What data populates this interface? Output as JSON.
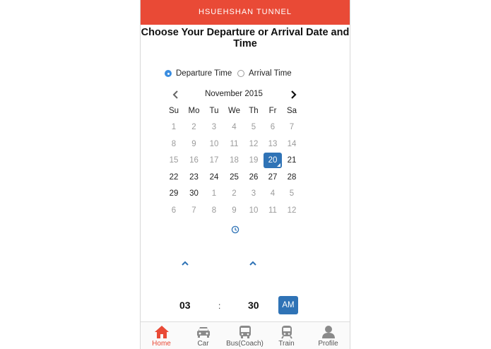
{
  "header": {
    "title": "HSUEHSHAN TUNNEL"
  },
  "heading": {
    "text": "Choose Your Departure or Arrival Date and Time"
  },
  "mode": {
    "options": [
      {
        "label": "Departure Time",
        "selected": true
      },
      {
        "label": "Arrival Time",
        "selected": false
      }
    ]
  },
  "calendar": {
    "month_label": "November 2015",
    "weekdays": [
      "Su",
      "Mo",
      "Tu",
      "We",
      "Th",
      "Fr",
      "Sa"
    ],
    "weeks": [
      [
        "1",
        "2",
        "3",
        "4",
        "5",
        "6",
        "7"
      ],
      [
        "8",
        "9",
        "10",
        "11",
        "12",
        "13",
        "14"
      ],
      [
        "15",
        "16",
        "17",
        "18",
        "19",
        "20",
        "21"
      ],
      [
        "22",
        "23",
        "24",
        "25",
        "26",
        "27",
        "28"
      ],
      [
        "29",
        "30",
        "1",
        "2",
        "3",
        "4",
        "5"
      ],
      [
        "6",
        "7",
        "8",
        "9",
        "10",
        "11",
        "12"
      ]
    ],
    "selected_day": "20"
  },
  "time": {
    "hour": "03",
    "separator": ":",
    "minute": "30",
    "period": "AM"
  },
  "tabs": [
    {
      "label": "Home",
      "icon": "home-icon"
    },
    {
      "label": "Car",
      "icon": "car-icon"
    },
    {
      "label": "Bus(Coach)",
      "icon": "bus-icon"
    },
    {
      "label": "Train",
      "icon": "train-icon"
    },
    {
      "label": "Profile",
      "icon": "profile-icon"
    }
  ],
  "colors": {
    "header": "#e94a36",
    "accent": "#2f73b6",
    "active_tab": "#e94a36"
  }
}
